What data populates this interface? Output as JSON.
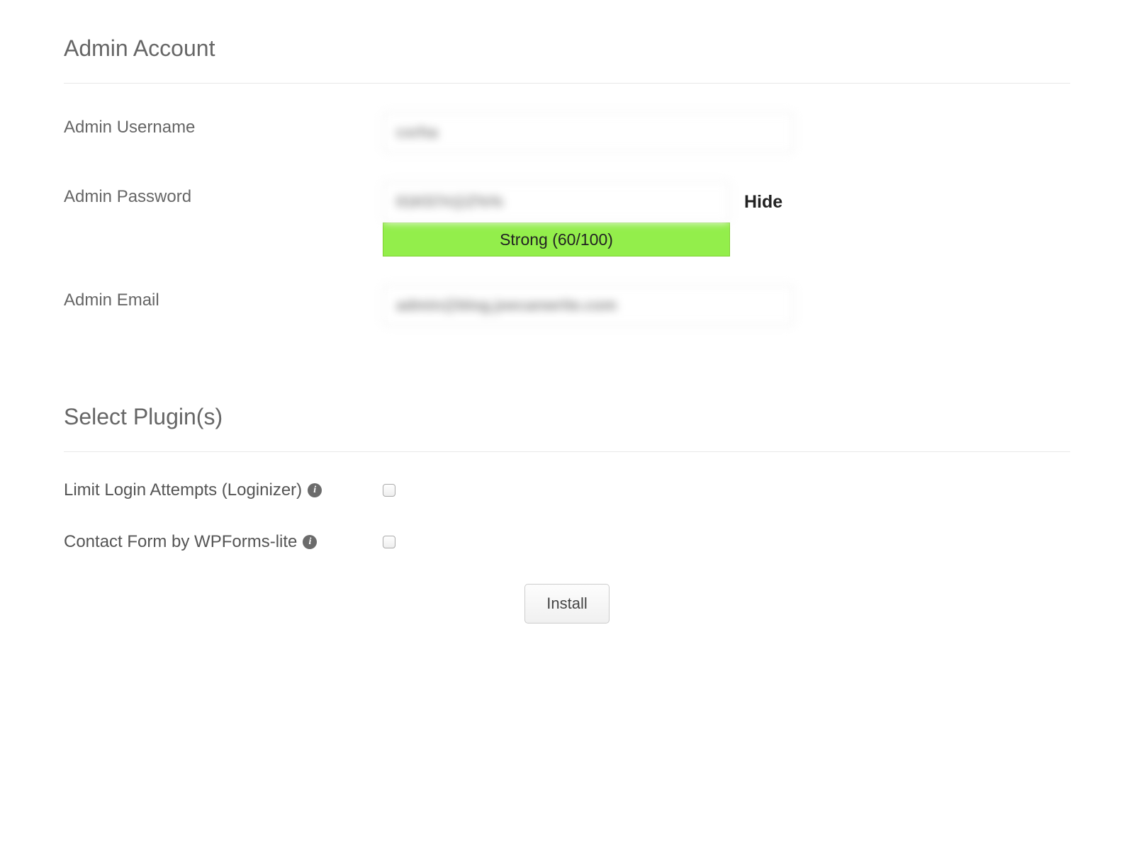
{
  "admin": {
    "title": "Admin Account",
    "username": {
      "label": "Admin Username",
      "value": "cxrha"
    },
    "password": {
      "label": "Admin Password",
      "value": "01K57#@Z%%",
      "toggle": "Hide",
      "strength_text": "Strong (60/100)",
      "strength_color": "#93ee4b"
    },
    "email": {
      "label": "Admin Email",
      "value": "admin@blog.joecanwrite.com"
    }
  },
  "plugins": {
    "title": "Select Plugin(s)",
    "items": [
      {
        "label": "Limit Login Attempts (Loginizer)",
        "checked": false
      },
      {
        "label": "Contact Form by WPForms-lite",
        "checked": false
      }
    ]
  },
  "install_label": "Install"
}
